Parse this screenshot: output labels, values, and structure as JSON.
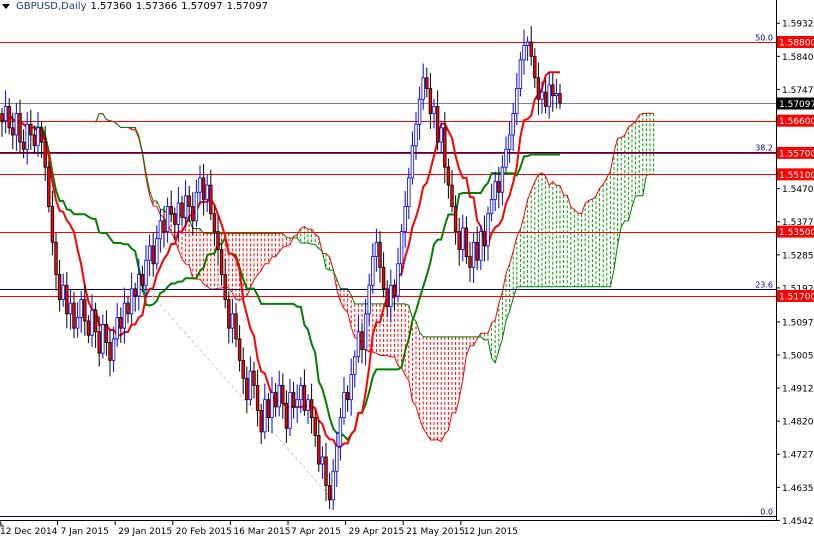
{
  "header": {
    "symbol": "GBPUSD,Daily",
    "open": "1.57360",
    "high": "1.57366",
    "low": "1.57097",
    "close": "1.57097"
  },
  "colors": {
    "bull": "#0000ff",
    "bear_fill": "#ff0000",
    "bear_outline": "#000000",
    "tenkan": "#ff0000",
    "kijun": "#008000",
    "cloud_bear": "#ff0000",
    "cloud_bull": "#00a000",
    "level": "#ff0000",
    "fib": "#00008b",
    "current": "#808080"
  },
  "chart_data": {
    "type": "candlestick",
    "title": "GBPUSD,Daily",
    "closes": [
      1.566,
      1.57,
      1.564,
      1.562,
      1.568,
      1.56,
      1.558,
      1.565,
      1.562,
      1.559,
      1.564,
      1.56,
      1.553,
      1.542,
      1.532,
      1.523,
      1.516,
      1.52,
      1.512,
      1.515,
      1.508,
      1.511,
      1.516,
      1.51,
      1.506,
      1.513,
      1.507,
      1.501,
      1.509,
      1.504,
      1.499,
      1.505,
      1.511,
      1.508,
      1.515,
      1.512,
      1.519,
      1.517,
      1.523,
      1.52,
      1.527,
      1.531,
      1.526,
      1.533,
      1.538,
      1.535,
      1.542,
      1.54,
      1.537,
      1.543,
      1.539,
      1.545,
      1.542,
      1.538,
      1.546,
      1.55,
      1.544,
      1.548,
      1.54,
      1.535,
      1.53,
      1.523,
      1.516,
      1.508,
      1.512,
      1.505,
      1.499,
      1.494,
      1.488,
      1.496,
      1.492,
      1.485,
      1.479,
      1.488,
      1.483,
      1.49,
      1.486,
      1.492,
      1.487,
      1.48,
      1.49,
      1.486,
      1.488,
      1.492,
      1.485,
      1.488,
      1.483,
      1.478,
      1.47,
      1.472,
      1.464,
      1.46,
      1.468,
      1.475,
      1.483,
      1.49,
      1.488,
      1.495,
      1.5,
      1.507,
      1.502,
      1.512,
      1.52,
      1.528,
      1.532,
      1.525,
      1.519,
      1.514,
      1.52,
      1.517,
      1.526,
      1.535,
      1.542,
      1.55,
      1.559,
      1.565,
      1.572,
      1.578,
      1.575,
      1.568,
      1.57,
      1.56,
      1.564,
      1.553,
      1.548,
      1.542,
      1.535,
      1.53,
      1.536,
      1.528,
      1.525,
      1.532,
      1.527,
      1.535,
      1.531,
      1.54,
      1.544,
      1.549,
      1.546,
      1.553,
      1.558,
      1.562,
      1.568,
      1.575,
      1.583,
      1.587,
      1.588,
      1.584,
      1.578,
      1.572,
      1.574,
      1.57,
      1.576,
      1.573,
      1.5736,
      1.571
    ],
    "y_ticks": [
      "1.59325",
      "1.58400",
      "1.57475",
      "1.54700",
      "1.53775",
      "1.52850",
      "1.51925",
      "1.50975",
      "1.50050",
      "1.49125",
      "1.48200",
      "1.47275",
      "1.46350",
      "1.45425"
    ],
    "x_ticks": [
      {
        "label": "12 Dec 2014",
        "bar": 0
      },
      {
        "label": "7 Jan 2015",
        "bar": 16
      },
      {
        "label": "29 Jan 2015",
        "bar": 32
      },
      {
        "label": "20 Feb 2015",
        "bar": 48
      },
      {
        "label": "16 Mar 2015",
        "bar": 64
      },
      {
        "label": "7 Apr 2015",
        "bar": 80
      },
      {
        "label": "29 Apr 2015",
        "bar": 96
      },
      {
        "label": "21 May 2015",
        "bar": 112
      },
      {
        "label": "12 Jun 2015",
        "bar": 128
      }
    ],
    "levels": [
      {
        "price": 1.588,
        "label": "1.58800"
      },
      {
        "price": 1.566,
        "label": "1.56600"
      },
      {
        "price": 1.557,
        "label": "1.55700"
      },
      {
        "price": 1.551,
        "label": "1.55100"
      },
      {
        "price": 1.535,
        "label": "1.53500"
      },
      {
        "price": 1.517,
        "label": "1.51700"
      }
    ],
    "fibonacci": [
      {
        "label": "50.0",
        "price": 1.588
      },
      {
        "label": "38.2",
        "price": 1.5572
      },
      {
        "label": "23.6",
        "price": 1.519
      },
      {
        "label": "0.0",
        "price": 1.4555
      }
    ],
    "current_price": {
      "price": 1.57097,
      "label": "1.57097"
    }
  }
}
